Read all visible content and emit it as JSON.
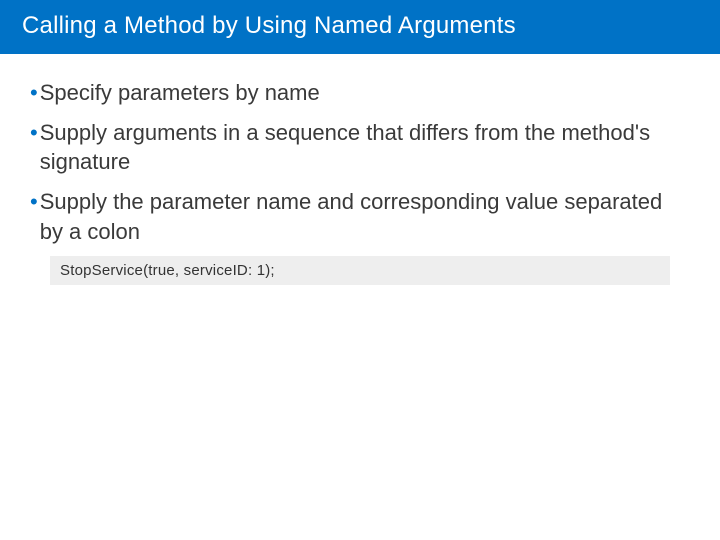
{
  "title": "Calling a Method by Using Named Arguments",
  "bullets": [
    "Specify parameters by name",
    "Supply arguments in a sequence that differs from the method's signature",
    "Supply the parameter name and corresponding value separated by a colon"
  ],
  "code": "StopService(true, serviceID: 1);"
}
